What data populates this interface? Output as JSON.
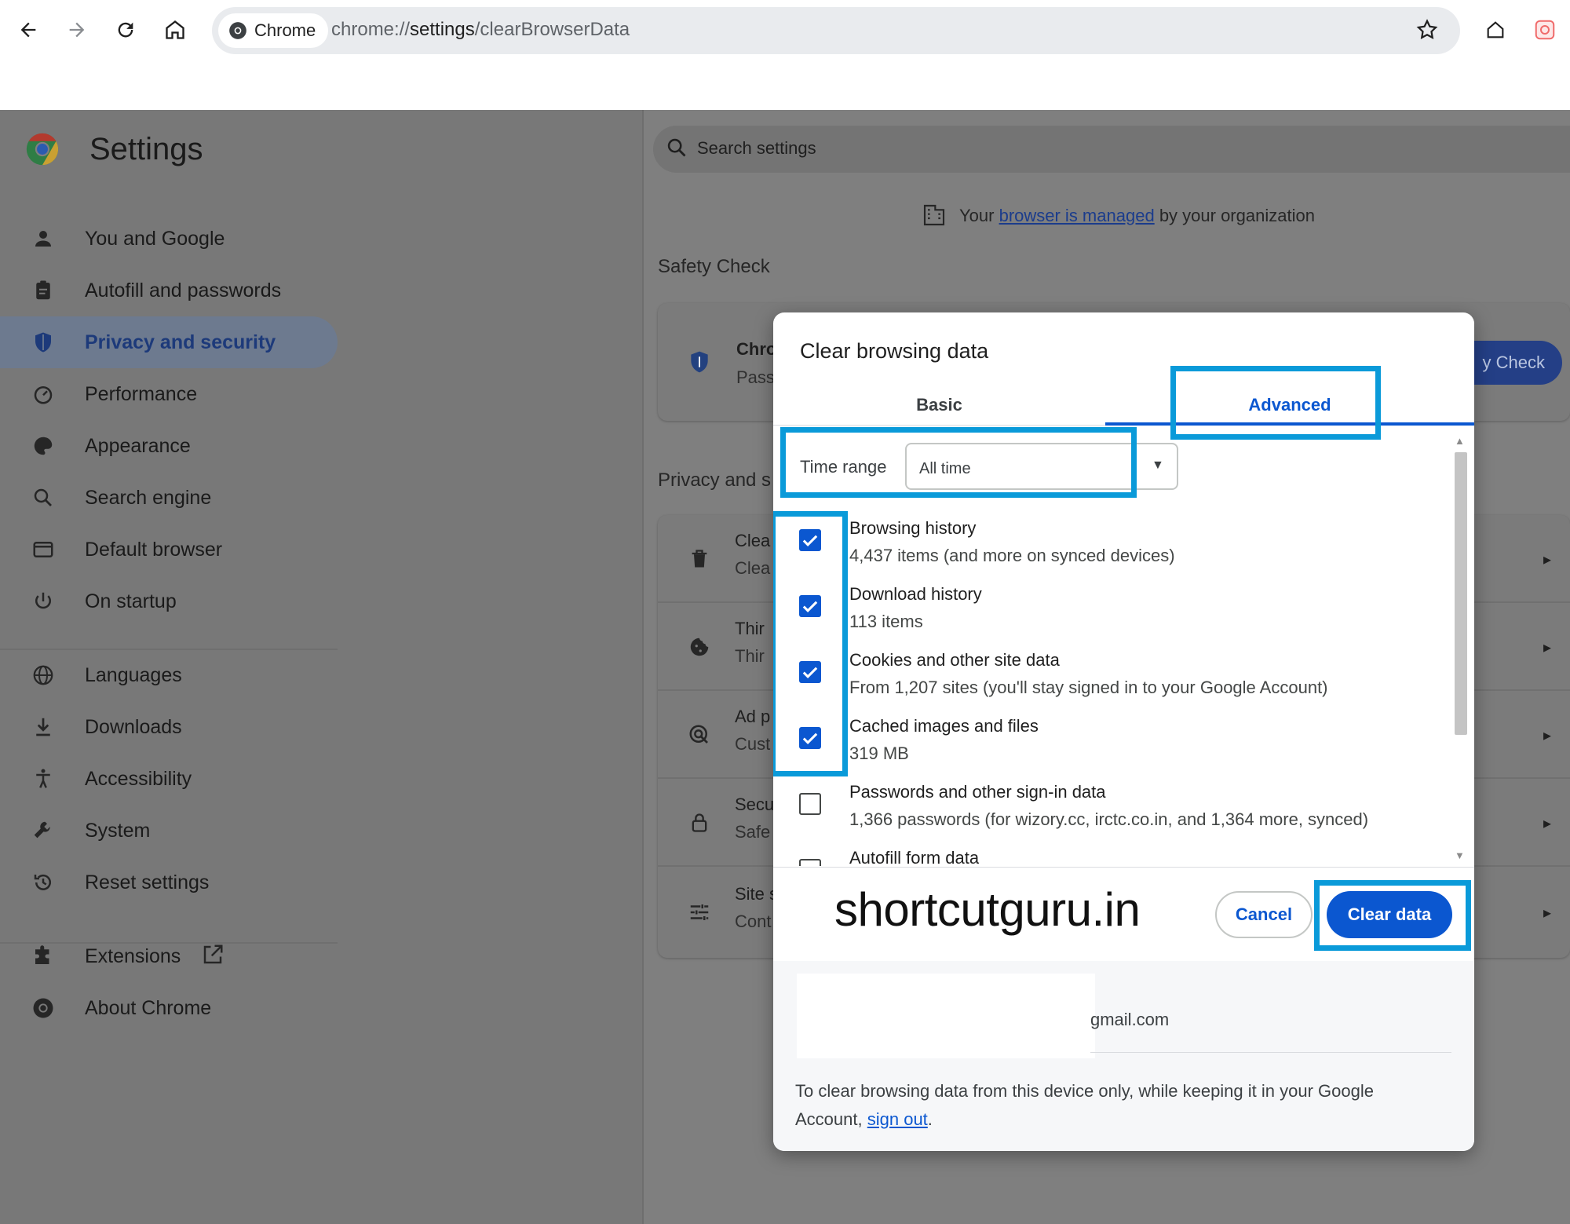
{
  "browser": {
    "chip_label": "Chrome",
    "url_prefix": "chrome://",
    "url_host": "settings",
    "url_path": "/clearBrowserData"
  },
  "settings": {
    "title": "Settings",
    "nav": [
      {
        "label": "You and Google",
        "icon": "person-icon"
      },
      {
        "label": "Autofill and passwords",
        "icon": "clipboard-icon"
      },
      {
        "label": "Privacy and security",
        "icon": "shield-icon",
        "active": true
      },
      {
        "label": "Performance",
        "icon": "gauge-icon"
      },
      {
        "label": "Appearance",
        "icon": "palette-icon"
      },
      {
        "label": "Search engine",
        "icon": "search-icon"
      },
      {
        "label": "Default browser",
        "icon": "browser-icon"
      },
      {
        "label": "On startup",
        "icon": "power-icon"
      },
      {
        "label": "Languages",
        "icon": "globe-icon"
      },
      {
        "label": "Downloads",
        "icon": "download-icon"
      },
      {
        "label": "Accessibility",
        "icon": "accessibility-icon"
      },
      {
        "label": "System",
        "icon": "wrench-icon"
      },
      {
        "label": "Reset settings",
        "icon": "history-icon"
      },
      {
        "label": "Extensions",
        "icon": "puzzle-icon"
      },
      {
        "label": "About Chrome",
        "icon": "chrome-icon"
      }
    ],
    "search_placeholder": "Search settings",
    "managed_prefix": "Your",
    "managed_link": "browser is managed",
    "managed_suffix": "by your organization",
    "safety_check_heading": "Safety Check",
    "safety_row_title": "Chro",
    "safety_row_sub": "Pass",
    "safety_button": "y Check",
    "privacy_heading": "Privacy and s",
    "privacy_rows": [
      {
        "title": "Clea",
        "sub": "Clea",
        "icon": "trash-icon"
      },
      {
        "title": "Thir",
        "sub": "Thir",
        "icon": "cookie-icon"
      },
      {
        "title": "Ad p",
        "sub": "Cust",
        "icon": "ad-privacy-icon"
      },
      {
        "title": "Secu",
        "sub": "Safe",
        "icon": "lock-icon"
      },
      {
        "title": "Site s",
        "sub": "Cont",
        "icon": "sliders-icon"
      }
    ]
  },
  "dialog": {
    "title": "Clear browsing data",
    "tabs": {
      "basic": "Basic",
      "advanced": "Advanced"
    },
    "time_range_label": "Time range",
    "time_range_value": "All time",
    "options": [
      {
        "title": "Browsing history",
        "sub": "4,437 items (and more on synced devices)",
        "checked": true
      },
      {
        "title": "Download history",
        "sub": "113 items",
        "checked": true
      },
      {
        "title": "Cookies and other site data",
        "sub": "From 1,207 sites (you'll stay signed in to your Google Account)",
        "checked": true
      },
      {
        "title": "Cached images and files",
        "sub": "319 MB",
        "checked": true
      },
      {
        "title": "Passwords and other sign-in data",
        "sub": "1,366 passwords (for wizory.cc, irctc.co.in, and 1,364 more, synced)",
        "checked": false
      },
      {
        "title": "Autofill form data",
        "sub": "",
        "checked": false
      }
    ],
    "watermark": "shortcutguru.in",
    "cancel_label": "Cancel",
    "clear_label": "Clear data",
    "account_email": "gmail.com",
    "note_text": "To clear browsing data from this device only, while keeping it in your Google Account,",
    "note_link": "sign out",
    "note_end": "."
  },
  "colors": {
    "accent": "#0b57d0",
    "highlight_box": "#0a9ad9",
    "overlay": "#7f7f7f"
  }
}
